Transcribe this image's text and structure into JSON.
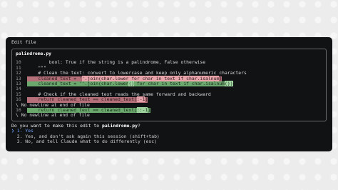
{
  "window": {
    "title": "Edit file"
  },
  "file": {
    "name": "palindrome.py"
  },
  "lines": [
    {
      "num": "10",
      "type": "context",
      "parts": [
        {
          "t": "        bool: True if the string is a palindrome, False otherwise"
        }
      ]
    },
    {
      "num": "11",
      "type": "context",
      "parts": [
        {
          "t": "    \"\"\""
        }
      ]
    },
    {
      "num": "12",
      "type": "context",
      "parts": [
        {
          "t": "    # Clean the text: convert to lowercase and keep only alphanumeric characters"
        }
      ]
    },
    {
      "num": "13",
      "type": "removed",
      "parts": [
        {
          "t": "    cleaned_text = '"
        },
        {
          "t": "'.join(char.lower for char in text if char.isalnum",
          "hl": true
        },
        {
          "t": ")"
        }
      ]
    },
    {
      "num": "13",
      "type": "added",
      "parts": [
        {
          "t": "    cleaned_text = ''.join(char.lower"
        },
        {
          "t": "()",
          "hl": true
        },
        {
          "t": " for char in text if char.isalnum"
        },
        {
          "t": "())",
          "hl": true
        }
      ]
    },
    {
      "num": "14",
      "type": "context",
      "parts": [
        {
          "t": ""
        }
      ]
    },
    {
      "num": "15",
      "type": "context",
      "parts": [
        {
          "t": "    # Check if the cleaned text reads the same forward and backward"
        }
      ]
    },
    {
      "num": "16",
      "type": "removed",
      "parts": [
        {
          "t": "    return cleaned_text == cleaned_text["
        },
        {
          "t": ":-1",
          "hl": true
        },
        {
          "t": "]"
        }
      ]
    },
    {
      "num": "17",
      "type": "plain",
      "parts": [
        {
          "t": "\\ No newline at end of file"
        }
      ]
    },
    {
      "num": "16",
      "type": "added",
      "parts": [
        {
          "t": "    return cleaned_text == cleaned_text["
        },
        {
          "t": "::-1",
          "hl": true
        },
        {
          "t": "]"
        }
      ]
    },
    {
      "num": "18",
      "type": "plain",
      "parts": [
        {
          "t": "\\ No newline at end of file"
        }
      ]
    }
  ],
  "prompt": {
    "before": "Do you want to make this edit to ",
    "file": "palindrome.py",
    "after": "?"
  },
  "options": [
    {
      "cursor": "❯",
      "label": "1. Yes",
      "selected": true
    },
    {
      "cursor": " ",
      "label": "2. Yes, and don't ask again this session (shift+tab)",
      "selected": false
    },
    {
      "cursor": " ",
      "label": "3. No, and tell Claude what to do differently (esc)",
      "selected": false
    }
  ]
}
